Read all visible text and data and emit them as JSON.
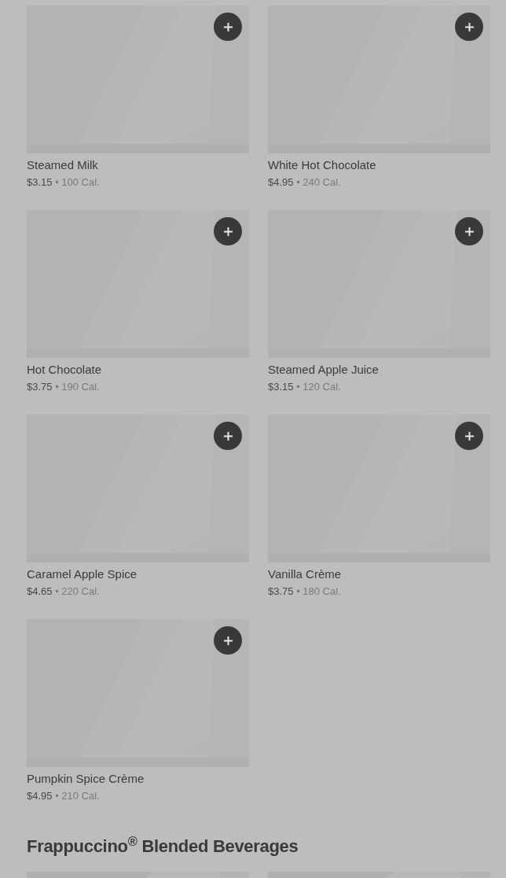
{
  "sections": [
    {
      "items": [
        {
          "kind": "product",
          "name": "Steamed Milk",
          "price": "$3.15",
          "calories": "• 100 Cal."
        },
        {
          "kind": "product",
          "name": "White Hot Chocolate",
          "price": "$4.95",
          "calories": "• 240 Cal."
        },
        {
          "kind": "product",
          "name": "Hot Chocolate",
          "price": "$3.75",
          "calories": "• 190 Cal."
        },
        {
          "kind": "product",
          "name": "Steamed Apple Juice",
          "price": "$3.15",
          "calories": "• 120 Cal."
        },
        {
          "kind": "product",
          "name": "Caramel Apple Spice",
          "price": "$4.65",
          "calories": "• 220 Cal."
        },
        {
          "kind": "product",
          "name": "Vanilla Crème",
          "price": "$3.75",
          "calories": "• 180 Cal."
        },
        {
          "kind": "product",
          "name": "Pumpkin Spice Crème",
          "price": "$4.95",
          "calories": "• 210 Cal."
        }
      ]
    },
    {
      "title": "Frappuccino$^{®}$ Blended Beverages"
    }
  ]
}
